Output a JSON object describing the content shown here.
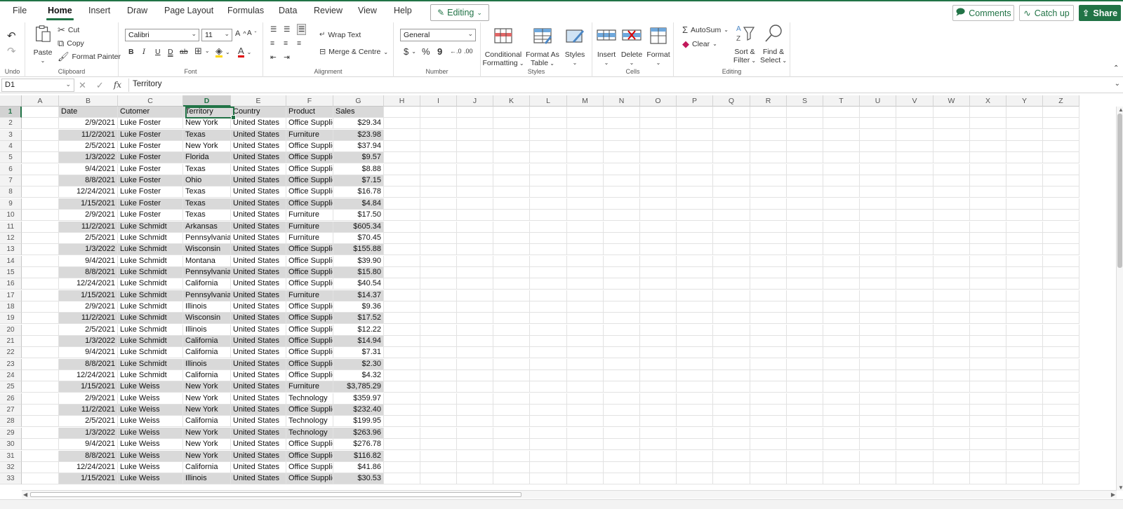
{
  "tabs": [
    "File",
    "Home",
    "Insert",
    "Draw",
    "Page Layout",
    "Formulas",
    "Data",
    "Review",
    "View",
    "Help"
  ],
  "editing_label": "Editing",
  "comments_label": "Comments",
  "catchup_label": "Catch up",
  "share_label": "Share",
  "ribbon": {
    "undo_group": "Undo",
    "clipboard": {
      "paste": "Paste",
      "cut": "Cut",
      "copy": "Copy",
      "format_painter": "Format Painter",
      "label": "Clipboard"
    },
    "font": {
      "name": "Calibri",
      "size": "11",
      "bold": "B",
      "italic": "I",
      "underline": "U",
      "double_underline": "D",
      "strike": "ab",
      "label": "Font"
    },
    "alignment": {
      "wrap": "Wrap Text",
      "merge": "Merge & Centre",
      "label": "Alignment"
    },
    "number": {
      "format": "General",
      "dollar": "$",
      "percent": "%",
      "comma": "9",
      "label": "Number"
    },
    "styles": {
      "conditional_1": "Conditional",
      "conditional_2": "Formatting",
      "table_1": "Format As",
      "table_2": "Table",
      "styles": "Styles",
      "label": "Styles"
    },
    "cells": {
      "insert": "Insert",
      "delete": "Delete",
      "format": "Format",
      "label": "Cells"
    },
    "editing": {
      "autosum": "AutoSum",
      "clear": "Clear",
      "sort_1": "Sort &",
      "sort_2": "Filter",
      "find_1": "Find &",
      "find_2": "Select",
      "label": "Editing"
    }
  },
  "formula_bar": {
    "name_box": "D1",
    "fx": "fx",
    "content": "Territory"
  },
  "columns": [
    "A",
    "B",
    "C",
    "D",
    "E",
    "F",
    "G",
    "H",
    "I",
    "J",
    "K",
    "L",
    "M",
    "N",
    "O",
    "P",
    "Q",
    "R",
    "S",
    "T",
    "U",
    "V",
    "W",
    "X",
    "Y",
    "Z"
  ],
  "headers": {
    "date": "Date",
    "customer": "Cutomer",
    "territory": "Territory",
    "country": "Country",
    "product": "Product",
    "sales": "Sales"
  },
  "rows": [
    [
      "2/9/2021",
      "Luke Foster",
      "New York",
      "United States",
      "Office Supplies",
      "$29.34"
    ],
    [
      "11/2/2021",
      "Luke Foster",
      "Texas",
      "United States",
      "Furniture",
      "$23.98"
    ],
    [
      "2/5/2021",
      "Luke Foster",
      "New York",
      "United States",
      "Office Supplies",
      "$37.94"
    ],
    [
      "1/3/2022",
      "Luke Foster",
      "Florida",
      "United States",
      "Office Supplies",
      "$9.57"
    ],
    [
      "9/4/2021",
      "Luke Foster",
      "Texas",
      "United States",
      "Office Supplies",
      "$8.88"
    ],
    [
      "8/8/2021",
      "Luke Foster",
      "Ohio",
      "United States",
      "Office Supplies",
      "$7.15"
    ],
    [
      "12/24/2021",
      "Luke Foster",
      "Texas",
      "United States",
      "Office Supplies",
      "$16.78"
    ],
    [
      "1/15/2021",
      "Luke Foster",
      "Texas",
      "United States",
      "Office Supplies",
      "$4.84"
    ],
    [
      "2/9/2021",
      "Luke Foster",
      "Texas",
      "United States",
      "Furniture",
      "$17.50"
    ],
    [
      "11/2/2021",
      "Luke Schmidt",
      "Arkansas",
      "United States",
      "Furniture",
      "$605.34"
    ],
    [
      "2/5/2021",
      "Luke Schmidt",
      "Pennsylvania",
      "United States",
      "Furniture",
      "$70.45"
    ],
    [
      "1/3/2022",
      "Luke Schmidt",
      "Wisconsin",
      "United States",
      "Office Supplies",
      "$155.88"
    ],
    [
      "9/4/2021",
      "Luke Schmidt",
      "Montana",
      "United States",
      "Office Supplies",
      "$39.90"
    ],
    [
      "8/8/2021",
      "Luke Schmidt",
      "Pennsylvania",
      "United States",
      "Office Supplies",
      "$15.80"
    ],
    [
      "12/24/2021",
      "Luke Schmidt",
      "California",
      "United States",
      "Office Supplies",
      "$40.54"
    ],
    [
      "1/15/2021",
      "Luke Schmidt",
      "Pennsylvania",
      "United States",
      "Furniture",
      "$14.37"
    ],
    [
      "2/9/2021",
      "Luke Schmidt",
      "Illinois",
      "United States",
      "Office Supplies",
      "$9.36"
    ],
    [
      "11/2/2021",
      "Luke Schmidt",
      "Wisconsin",
      "United States",
      "Office Supplies",
      "$17.52"
    ],
    [
      "2/5/2021",
      "Luke Schmidt",
      "Illinois",
      "United States",
      "Office Supplies",
      "$12.22"
    ],
    [
      "1/3/2022",
      "Luke Schmidt",
      "California",
      "United States",
      "Office Supplies",
      "$14.94"
    ],
    [
      "9/4/2021",
      "Luke Schmidt",
      "California",
      "United States",
      "Office Supplies",
      "$7.31"
    ],
    [
      "8/8/2021",
      "Luke Schmidt",
      "Illinois",
      "United States",
      "Office Supplies",
      "$2.30"
    ],
    [
      "12/24/2021",
      "Luke Schmidt",
      "California",
      "United States",
      "Office Supplies",
      "$4.32"
    ],
    [
      "1/15/2021",
      "Luke Weiss",
      "New York",
      "United States",
      "Furniture",
      "$3,785.29"
    ],
    [
      "2/9/2021",
      "Luke Weiss",
      "New York",
      "United States",
      "Technology",
      "$359.97"
    ],
    [
      "11/2/2021",
      "Luke Weiss",
      "New York",
      "United States",
      "Office Supplies",
      "$232.40"
    ],
    [
      "2/5/2021",
      "Luke Weiss",
      "California",
      "United States",
      "Technology",
      "$199.95"
    ],
    [
      "1/3/2022",
      "Luke Weiss",
      "New York",
      "United States",
      "Technology",
      "$263.96"
    ],
    [
      "9/4/2021",
      "Luke Weiss",
      "New York",
      "United States",
      "Office Supplies",
      "$276.78"
    ],
    [
      "8/8/2021",
      "Luke Weiss",
      "New York",
      "United States",
      "Office Supplies",
      "$116.82"
    ],
    [
      "12/24/2021",
      "Luke Weiss",
      "California",
      "United States",
      "Office Supplies",
      "$41.86"
    ],
    [
      "1/15/2021",
      "Luke Weiss",
      "Illinois",
      "United States",
      "Office Supplies",
      "$30.53"
    ]
  ],
  "row_numbers": [
    "1",
    "2",
    "3",
    "4",
    "5",
    "6",
    "7",
    "8",
    "9",
    "10",
    "11",
    "12",
    "13",
    "14",
    "15",
    "16",
    "17",
    "18",
    "19",
    "20",
    "21",
    "22",
    "23",
    "24",
    "25",
    "26",
    "27",
    "28",
    "29",
    "30",
    "31",
    "32",
    "33"
  ],
  "colors": {
    "accent": "#217346",
    "band": "#d9d9d9"
  }
}
